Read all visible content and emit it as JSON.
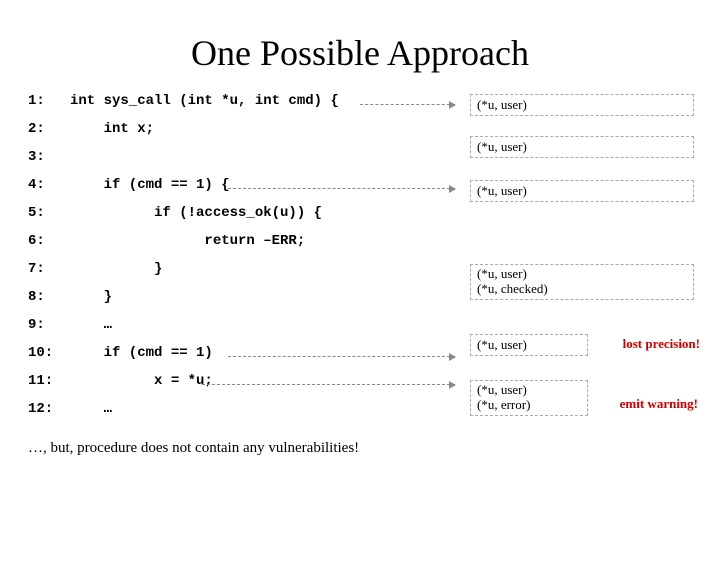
{
  "title": "One Possible Approach",
  "code": {
    "l1_ln": "1:",
    "l1": "int sys_call (int *u, int cmd) {",
    "l2_ln": "2:",
    "l2": "    int x;",
    "l3_ln": "3:",
    "l3": "",
    "l4_ln": "4:",
    "l4": "    if (cmd == 1) {",
    "l5_ln": "5:",
    "l5": "          if (!access_ok(u)) {",
    "l6_ln": "6:",
    "l6": "                return –ERR;",
    "l7_ln": "7:",
    "l7": "          }",
    "l8_ln": "8:",
    "l8": "    }",
    "l9_ln": "9:",
    "l9": "    …",
    "l10_ln": "10:",
    "l10": "    if (cmd == 1)",
    "l11_ln": "11:",
    "l11": "          x = *u;",
    "l12_ln": "12:",
    "l12": "    …"
  },
  "annot": {
    "a1": "(*u, user)",
    "a2": "(*u, user)",
    "a3": "(*u, user)",
    "a4_l1": "(*u, user)",
    "a4_l2": "(*u, checked)",
    "a5": "(*u, user)",
    "a6_l1": "(*u, user)",
    "a6_l2": "(*u, error)"
  },
  "side": {
    "s1": "lost precision!",
    "s2": "emit warning!"
  },
  "footer": "…, but, procedure does not contain any vulnerabilities!"
}
